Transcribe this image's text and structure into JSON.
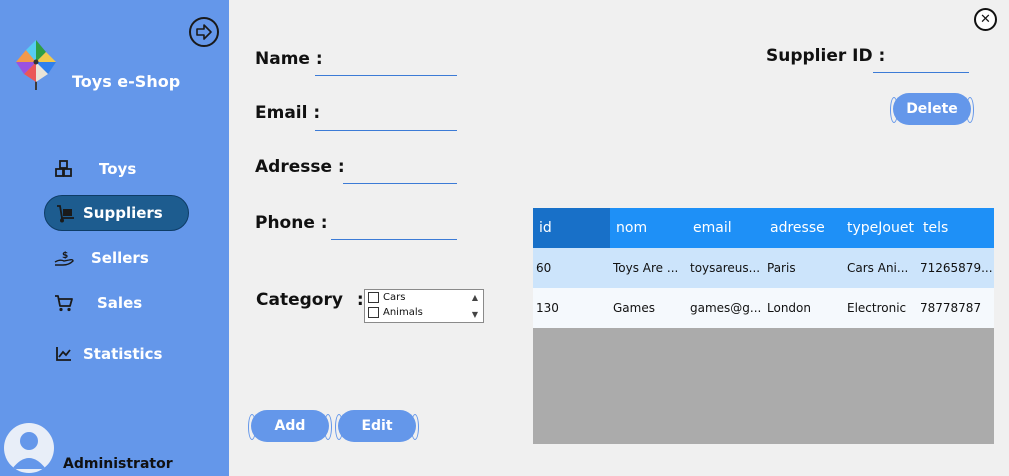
{
  "sidebar": {
    "brand": "Toys e-Shop",
    "nav": [
      {
        "label": "Toys",
        "icon": "boxes-icon"
      },
      {
        "label": "Suppliers",
        "icon": "hand-truck-icon",
        "active": true
      },
      {
        "label": "Sellers",
        "icon": "hand-money-icon"
      },
      {
        "label": "Sales",
        "icon": "cart-icon"
      },
      {
        "label": "Statistics",
        "icon": "chart-icon"
      }
    ],
    "user": "Administrator"
  },
  "form": {
    "name_label": "Name :",
    "email_label": "Email :",
    "address_label": "Adresse :",
    "phone_label": "Phone :",
    "category_label": "Category",
    "category_colon": ":",
    "supplier_id_label": "Supplier ID :",
    "name_value": "",
    "email_value": "",
    "address_value": "",
    "phone_value": "",
    "supplier_id_value": "",
    "categories": [
      {
        "label": "Cars",
        "checked": false
      },
      {
        "label": "Animals",
        "checked": false
      }
    ]
  },
  "buttons": {
    "delete": "Delete",
    "add": "Add",
    "edit": "Edit"
  },
  "table": {
    "columns": [
      "id",
      "nom",
      "email",
      "adresse",
      "typeJouet",
      "tels"
    ],
    "rows": [
      [
        "60",
        "Toys Are ...",
        "toysareus...",
        "Paris",
        "Cars Ani...",
        "71265879..."
      ],
      [
        "130",
        "Games",
        "games@g...",
        "London",
        "Electronic",
        "78778787"
      ]
    ]
  },
  "colors": {
    "sidebar": "#6497ea",
    "active_nav": "#1d5c8f",
    "header": "#1e90f7",
    "row_selected": "#cce4fb",
    "row_alt": "#f5f9fd",
    "grid_empty": "#ababab",
    "underline": "#3c7bd6"
  }
}
